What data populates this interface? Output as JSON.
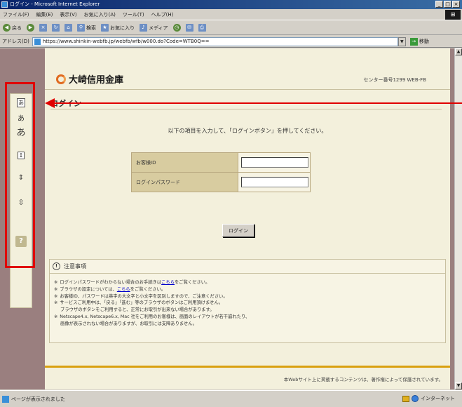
{
  "window": {
    "title": "ログイン - Microsoft Internet Explorer",
    "controls": [
      "_",
      "□",
      "×"
    ]
  },
  "menu": {
    "items": [
      "ファイル(F)",
      "編集(E)",
      "表示(V)",
      "お気に入り(A)",
      "ツール(T)",
      "ヘルプ(H)"
    ]
  },
  "toolbar": {
    "back": "戻る",
    "search": "検索",
    "favorites": "お気に入り",
    "media": "メディア"
  },
  "address": {
    "label": "アドレス(D)",
    "url": "https://www.shinkin-webfb.jp/webfb/wfb/w000.do?Code=WTB0Q==",
    "go": "移動"
  },
  "page": {
    "logo_text": "大崎信用金庫",
    "branch_info": "センター番号1299 WEB-FB",
    "title": "ログイン",
    "instructions": "以下の項目を入力して、「ログインボタン」を押してください。",
    "form": {
      "customer_id_label": "お客様ID",
      "password_label": "ログインパスワード"
    },
    "login_button": "ログイン",
    "notes_title": "注意事項",
    "notes": [
      {
        "pre": "ログインパスワードがわからない場合のお手続きは",
        "link": "こちら",
        "post": "をご覧ください。"
      },
      {
        "pre": "ブラウザの設定については、",
        "link": "こちら",
        "post": "をご覧ください。"
      },
      {
        "pre": "お客様ID、パスワードは英字の大文字と小文字を区別しますので、ご注意ください。",
        "link": "",
        "post": ""
      },
      {
        "pre": "サービスご利用中は、「戻る」「進む」等のブラウザのボタンはご利用頂けません。",
        "link": "",
        "post": ""
      },
      {
        "pre": "ブラウザのボタンをご利用すると、正常にお取引が出来ない場合があります。",
        "link": "",
        "post": ""
      },
      {
        "pre": "Netscape4.x, Netscape6.x, Mac 社をご利用のお客様は、画面のレイアウトが若干崩れたり、",
        "link": "",
        "post": ""
      },
      {
        "pre": "画像が表示されない場合がありますが、お取引には支障ありません。",
        "link": "",
        "post": ""
      }
    ],
    "footer": "本Webサイト上に掲載するコンテンツは、著作権によって保護されています。"
  },
  "a11y_bar": {
    "char_small": "あ",
    "char_medium": "あ",
    "char_large": "あ",
    "help": "?"
  },
  "status": {
    "text": "ページが表示されました",
    "zone": "インターネット"
  },
  "colors": {
    "accent": "#d9a010",
    "annotation": "#e00000",
    "form_label_bg": "#d8cca0",
    "page_bg": "#f3f0dc"
  }
}
